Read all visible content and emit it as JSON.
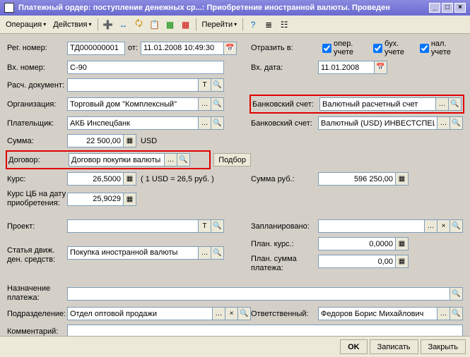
{
  "title": "Платежный ордер: поступление денежных ср...: Приобретение иностранной валюты. Проведен",
  "toolbar": {
    "operation": "Операция",
    "actions": "Действия",
    "go": "Перейти"
  },
  "labels": {
    "reg_no": "Рег. номер:",
    "from": "от:",
    "in_no": "Вх. номер:",
    "calc_doc": "Расч. документ:",
    "org": "Организация:",
    "payer": "Плательщик:",
    "sum": "Сумма:",
    "contract": "Договор:",
    "rate": "Курс:",
    "cb_rate": "Курс ЦБ на дату приобретения:",
    "project": "Проект:",
    "flow_item": "Статья движ. ден. средств:",
    "reflect": "Отразить в:",
    "in_date": "Вх. дата:",
    "bank_acc": "Банковский счет:",
    "bank_acc2": "Банковский счет:",
    "sum_rub": "Сумма руб.:",
    "planned": "Запланировано:",
    "plan_rate": "План. курс.:",
    "plan_sum": "План. сумма платежа:",
    "purpose": "Назначение платежа:",
    "dept": "Подразделение:",
    "resp": "Ответственный:",
    "comment": "Комментарий:",
    "select": "Подбор"
  },
  "reflect": {
    "opt1": "опер. учете",
    "opt2": "бух. учете",
    "opt3": "нал. учете"
  },
  "values": {
    "reg_no": "ТД000000001",
    "reg_date": "11.01.2008 10:49:30",
    "in_no": "С-90",
    "calc_doc": "",
    "org": "Торговый дом \"Комплексный\"",
    "payer": "АКБ Инспецбанк",
    "sum": "22 500,00",
    "currency": "USD",
    "contract": "Договор покупки валюты",
    "rate": "26,5000",
    "rate_note": "( 1 USD = 26,5 руб. )",
    "cb_rate": "25,9029",
    "project": "",
    "flow_item": "Покупка иностранной валюты",
    "in_date": "11.01.2008",
    "bank_acc": "Валютный расчетный счет",
    "bank_acc2": "Валютный (USD) ИНВЕСТСПЕЦБАНК",
    "sum_rub": "596 250,00",
    "planned": "",
    "plan_rate": "0,0000",
    "plan_sum": "0,00",
    "purpose": "",
    "dept": "Отдел оптовой продажи",
    "resp": "Федоров Борис Михайлович",
    "comment": ""
  },
  "buttons": {
    "ok": "OK",
    "save": "Записать",
    "close": "Закрыть"
  }
}
